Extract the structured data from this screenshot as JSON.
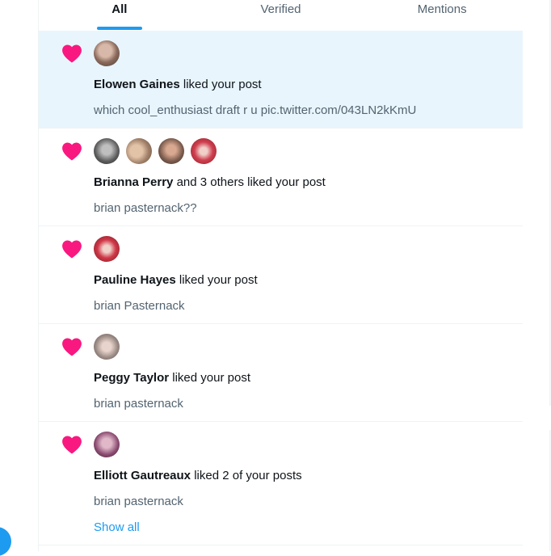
{
  "tabs": [
    {
      "label": "All",
      "active": true
    },
    {
      "label": "Verified",
      "active": false
    },
    {
      "label": "Mentions",
      "active": false
    }
  ],
  "notifications": [
    {
      "name": "Elowen Gaines",
      "action": "liked your post",
      "preview": "which cool_enthusiast draft r u pic.twitter.com/043LN2kKmU",
      "avatar_count": 1
    },
    {
      "name": "Brianna Perry",
      "action": "and 3 others liked your post",
      "preview": "brian pasternack??",
      "avatar_count": 4
    },
    {
      "name": "Pauline Hayes",
      "action": "liked your post",
      "preview": "brian Pasternack",
      "avatar_count": 1
    },
    {
      "name": "Peggy Taylor",
      "action": "liked your post",
      "preview": "brian pasternack",
      "avatar_count": 1
    },
    {
      "name": "Elliott Gautreaux",
      "action": "liked 2 of your posts",
      "preview": "brian pasternack",
      "avatar_count": 1,
      "link": "Show all"
    }
  ],
  "colors": {
    "accent": "#1d9bf0",
    "heart": "#f91880",
    "highlight": "#e8f5fd"
  },
  "icons": {
    "like": "heart-icon"
  }
}
